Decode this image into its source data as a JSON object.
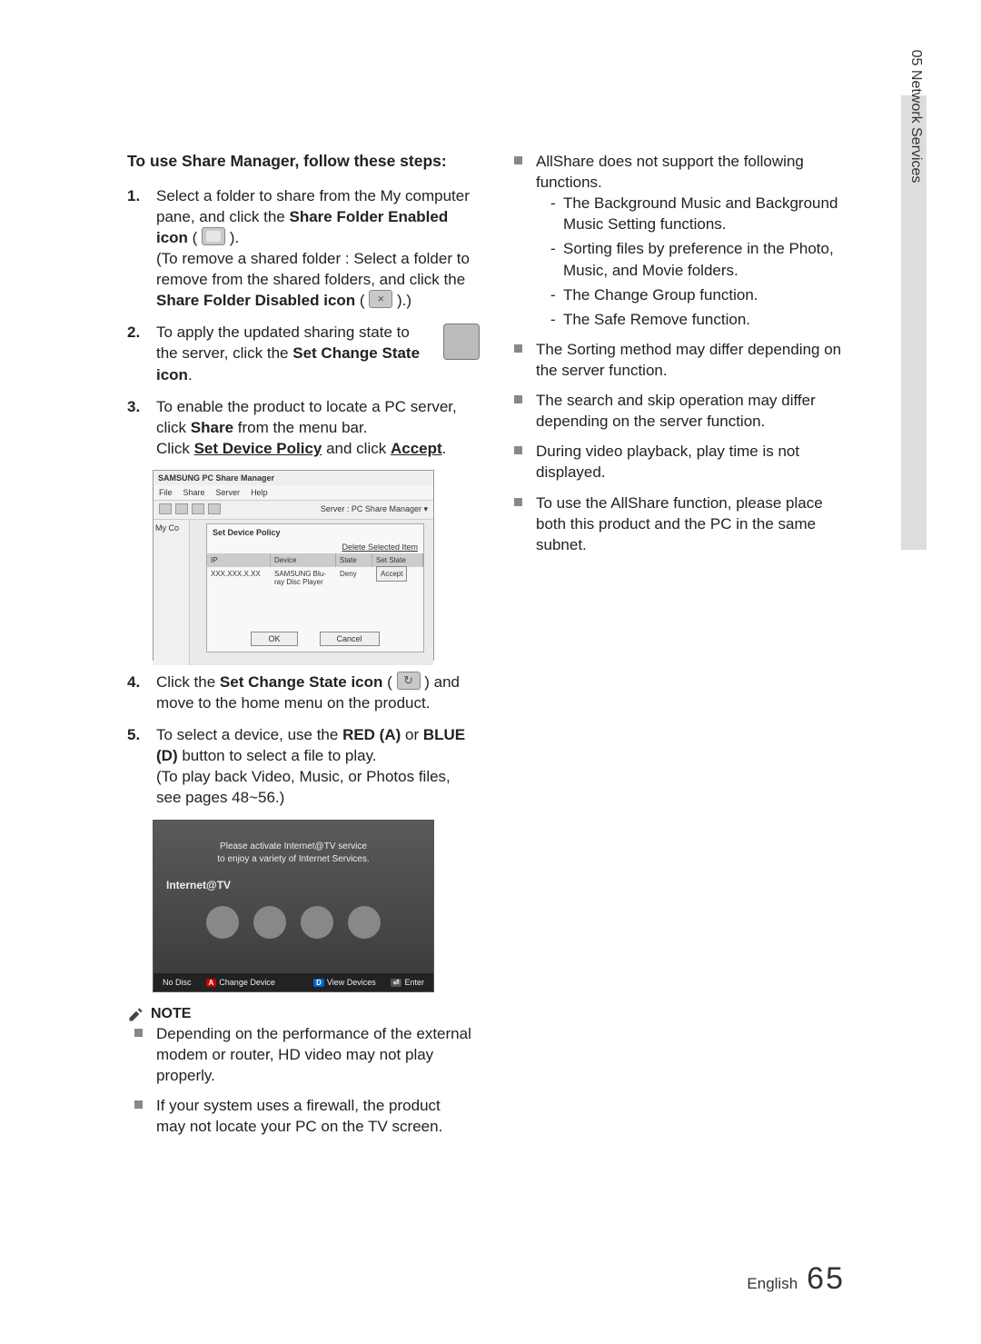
{
  "side_tab": "05  Network Services",
  "left": {
    "section_head": "To use Share Manager, follow these steps:",
    "step1_a": "Select a folder to share from the My computer pane, and click the ",
    "step1_b": "Share Folder Enabled icon",
    "step1_c": " ( ",
    "step1_d": " ).",
    "step1_e": "(To remove a shared folder : Select a folder to remove from the shared folders, and click the ",
    "step1_f": "Share Folder Disabled icon",
    "step1_g": " ( ",
    "step1_h": " ).)",
    "step2_a": "To apply the updated sharing state to the server, click the ",
    "step2_b": "Set Change State icon",
    "step2_c": ".",
    "step3_a": "To enable the product to locate a PC server, click ",
    "step3_b": "Share",
    "step3_c": " from the menu bar.",
    "step3_d": "Click ",
    "step3_e": "Set Device Policy",
    "step3_f": " and click ",
    "step3_g": "Accept",
    "step3_h": ".",
    "step4_a": "Click the ",
    "step4_b": "Set Change State icon",
    "step4_c": " ( ",
    "step4_d": " ) and move to the home menu on the product.",
    "step5_a": "To select a device, use the ",
    "step5_b": "RED (A)",
    "step5_c": " or ",
    "step5_d": "BLUE (D)",
    "step5_e": " button to select a file to play.",
    "step5_f": "(To play back Video, Music, or Photos files, see pages 48~56.)",
    "dlg": {
      "title": "SAMSUNG PC Share Manager",
      "menu": [
        "File",
        "Share",
        "Server",
        "Help"
      ],
      "server_label": "Server : PC Share Manager ▾",
      "side_label": "My Co",
      "overlay_title": "Set Device Policy",
      "delete_link": "Delete Selected Item",
      "th": [
        "IP",
        "Device",
        "State",
        "Set State"
      ],
      "row": [
        "XXX.XXX.X.XX",
        "SAMSUNG Blu-ray Disc Player",
        "Deny"
      ],
      "accept": "Accept",
      "ok": "OK",
      "cancel": "Cancel"
    },
    "tv": {
      "msg1": "Please activate Internet@TV service",
      "msg2": "to enjoy a variety of Internet Services.",
      "label": "Internet@TV",
      "bar_left": "No Disc",
      "bar_a": "Change Device",
      "bar_d": "View Devices",
      "bar_e": "Enter"
    },
    "note_label": "NOTE",
    "note1": "Depending on the performance of the external modem or router, HD video may not play properly.",
    "note2": "If your system uses a firewall, the product may not locate your PC on the TV screen."
  },
  "right": {
    "b1": "AllShare does not support the following functions.",
    "b1a": "The Background Music and Background Music Setting functions.",
    "b1b": "Sorting files by preference in the Photo, Music, and Movie folders.",
    "b1c": "The Change Group function.",
    "b1d": "The Safe Remove function.",
    "b2": "The Sorting method may differ depending on the server function.",
    "b3": "The search and skip operation may differ depending on the server function.",
    "b4": "During video playback, play time is not displayed.",
    "b5": "To use the AllShare function, please place both this product and the PC in the same subnet."
  },
  "footer_lang": "English",
  "footer_page": "65"
}
